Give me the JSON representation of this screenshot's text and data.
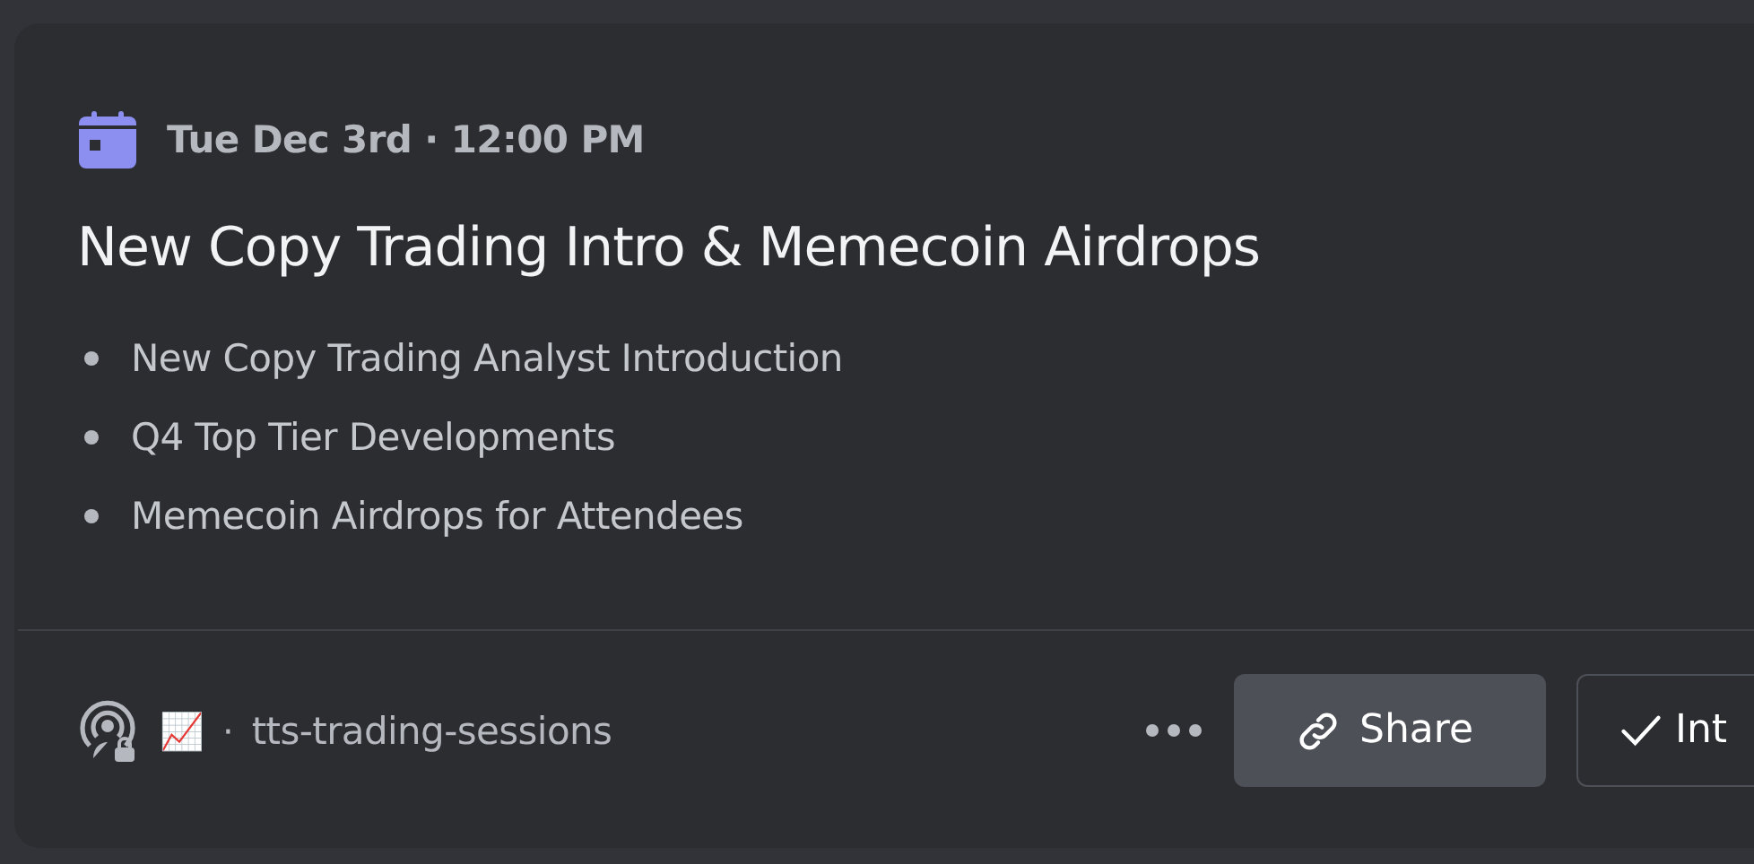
{
  "event": {
    "datetime": "Tue Dec 3rd · 12:00 PM",
    "title": "New Copy Trading Intro & Memecoin Airdrops",
    "bullets": [
      "New Copy Trading Analyst Introduction",
      "Q4 Top Tier Developments",
      "Memecoin Airdrops for Attendees"
    ],
    "channel_emoji": "📈",
    "separator": "·",
    "channel": "tts-trading-sessions",
    "buttons": [
      {
        "kind": "share",
        "label": "Share"
      },
      {
        "kind": "interested",
        "label": "Int"
      }
    ]
  }
}
